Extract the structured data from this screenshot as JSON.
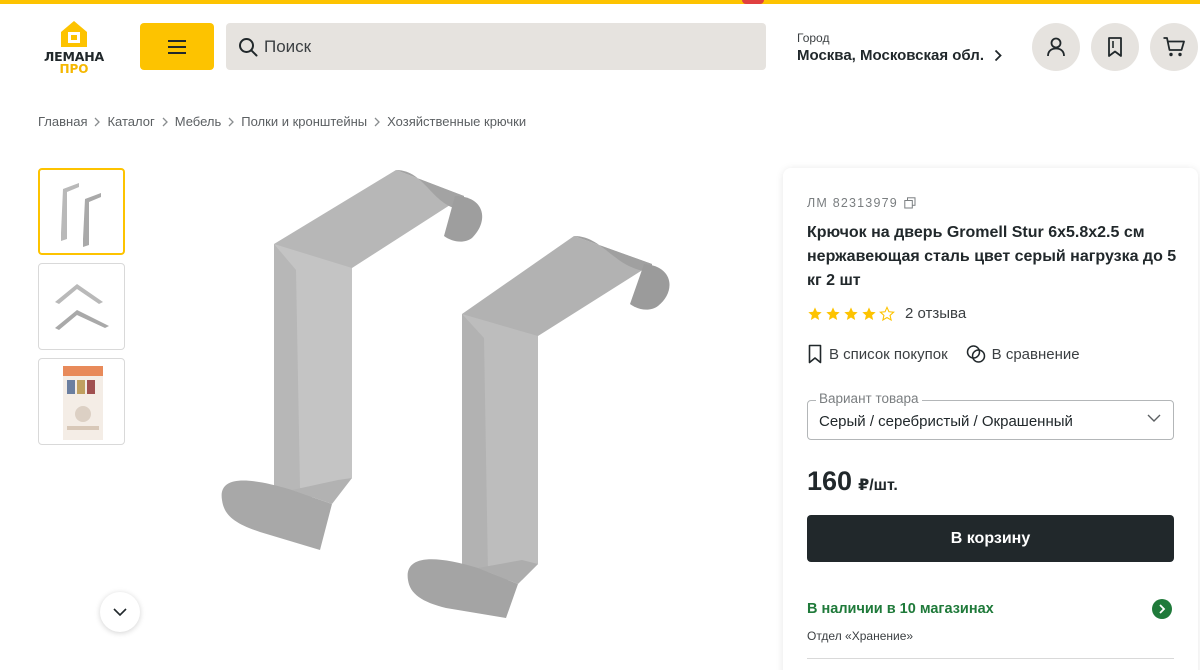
{
  "logo": {
    "line1": "ЛЕМАНА",
    "line2": "ПРО",
    "brand_color": "#fdc300"
  },
  "search": {
    "placeholder": "Поиск",
    "value": ""
  },
  "city": {
    "label": "Город",
    "value": "Москва, Московская обл."
  },
  "header_icons": [
    "menu-icon",
    "search-icon",
    "user-icon",
    "bookmark-icon",
    "cart-icon"
  ],
  "breadcrumb": [
    "Главная",
    "Каталог",
    "Мебель",
    "Полки и кронштейны",
    "Хозяйственные крючки"
  ],
  "thumbnails": [
    {
      "alt": "hooks-front"
    },
    {
      "alt": "hooks-side"
    },
    {
      "alt": "packaging"
    }
  ],
  "product": {
    "sku": "ЛМ 82313979",
    "title": "Крючок на дверь Gromell Stur 6x5.8x2.5 см нержавеющая сталь цвет серый нагрузка до 5 кг 2 шт",
    "rating": 4,
    "rating_max": 5,
    "reviews": "2 отзыва",
    "shopping_list": "В список покупок",
    "compare": "В сравнение",
    "variant_label": "Вариант товара",
    "variant_value": "Серый / серебристый / Окрашенный",
    "price": "160",
    "price_unit": "₽/шт.",
    "add_to_cart": "В корзину",
    "availability": "В наличии в 10 магазинах",
    "department": "Отдел «Хранение»"
  },
  "colors": {
    "accent": "#fdc300",
    "dark": "#21282b",
    "stock_green": "#1f7a3a",
    "star": "#fdc300"
  }
}
